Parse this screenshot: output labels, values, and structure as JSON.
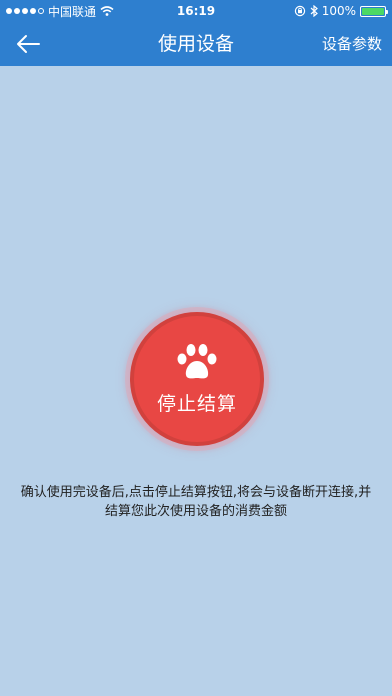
{
  "status_bar": {
    "carrier": "中国联通",
    "time": "16:19",
    "battery_percent": "100%",
    "battery_level": 1.0,
    "signal_bars_filled": 4,
    "icons": [
      "signal-dots-icon",
      "wifi-icon",
      "orientation-lock-icon",
      "bluetooth-icon",
      "battery-icon"
    ]
  },
  "nav": {
    "title": "使用设备",
    "right_action": "设备参数",
    "back_icon": "back-arrow-icon"
  },
  "main": {
    "stop_button_label": "停止结算",
    "button_icon": "paw-icon",
    "hint_text": "确认使用完设备后,点击停止结算按钮,将会与设备断开连接,并结算您此次使用设备的消费金额"
  },
  "colors": {
    "header": "#2e7fcf",
    "background": "#b8d1e9",
    "button": "#e84744",
    "battery_fill": "#4cd964"
  }
}
